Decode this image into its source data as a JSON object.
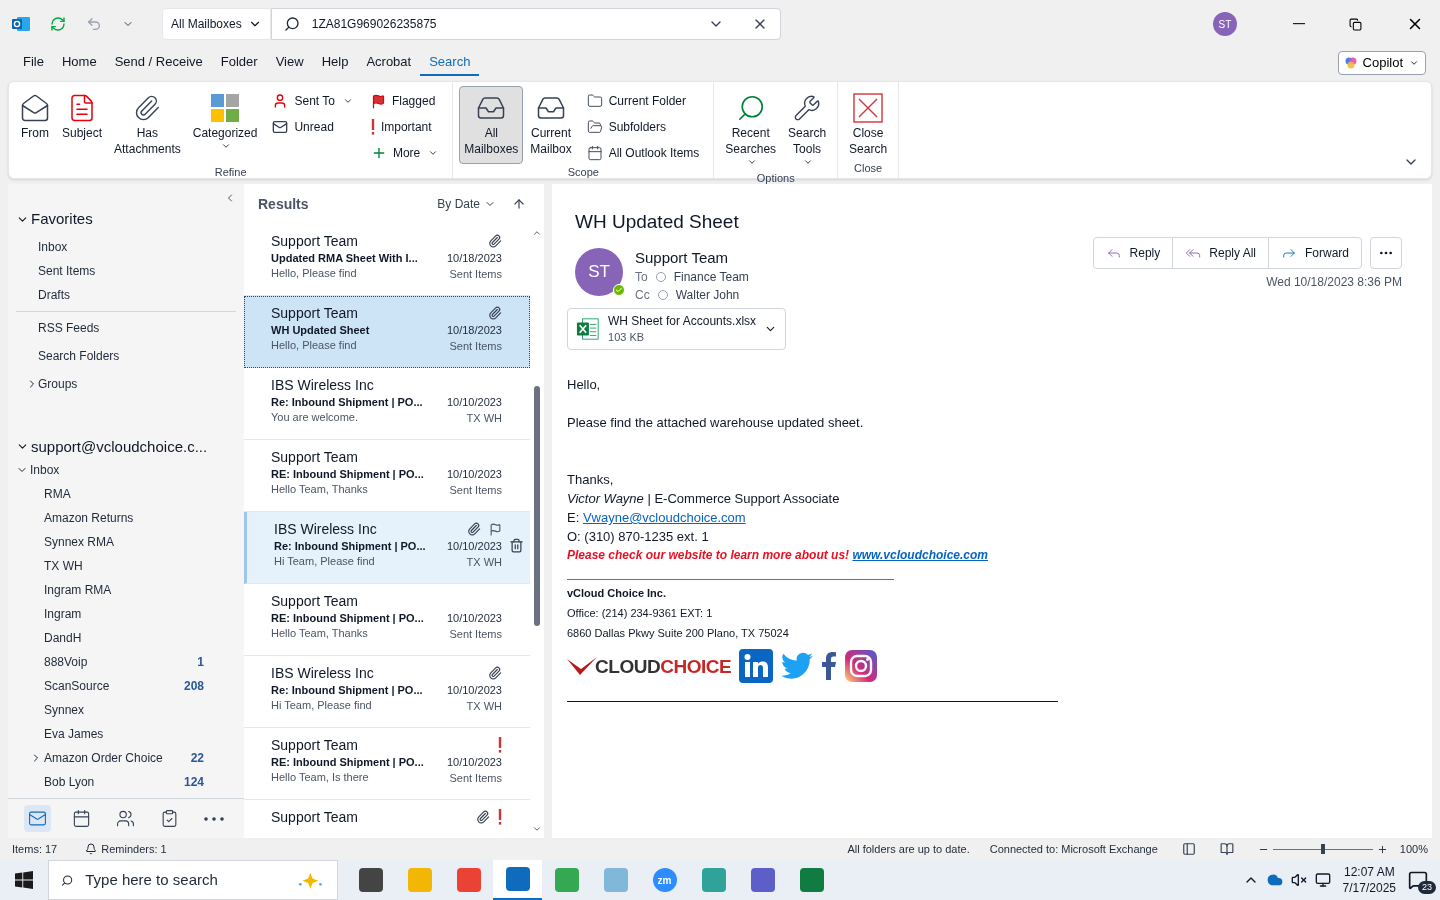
{
  "titlebar": {
    "mailbox_scope": "All Mailboxes",
    "search_query": "1ZA81G969026235875",
    "avatar": "ST"
  },
  "menu_tabs": [
    {
      "label": "File",
      "selected": false
    },
    {
      "label": "Home",
      "selected": false
    },
    {
      "label": "Send / Receive",
      "selected": false
    },
    {
      "label": "Folder",
      "selected": false
    },
    {
      "label": "View",
      "selected": false
    },
    {
      "label": "Help",
      "selected": false
    },
    {
      "label": "Acrobat",
      "selected": false
    },
    {
      "label": "Search",
      "selected": true
    }
  ],
  "copilot": "Copilot",
  "ribbon_groups": [
    {
      "label": "Refine",
      "large": [
        {
          "label": "From",
          "dropdown": false,
          "selected": false
        },
        {
          "label": "Subject",
          "dropdown": false,
          "selected": false
        },
        {
          "label": "Has Attachments",
          "dropdown": false,
          "selected": false
        },
        {
          "label": "Categorized",
          "dropdown": true,
          "selected": false
        }
      ],
      "columns": [
        [
          {
            "label": "Sent To",
            "dropdown": true
          },
          {
            "label": "Unread",
            "dropdown": false
          }
        ],
        [
          {
            "label": "Flagged",
            "dropdown": false
          },
          {
            "label": "Important",
            "dropdown": false
          },
          {
            "label": "More",
            "dropdown": true
          }
        ]
      ]
    },
    {
      "label": "Scope",
      "large": [
        {
          "label": "All Mailboxes",
          "dropdown": false,
          "selected": true
        },
        {
          "label": "Current Mailbox",
          "dropdown": false,
          "selected": false
        }
      ],
      "columns": [
        [
          {
            "label": "Current Folder",
            "dropdown": false
          },
          {
            "label": "Subfolders",
            "dropdown": false
          },
          {
            "label": "All Outlook Items",
            "dropdown": false
          }
        ]
      ]
    },
    {
      "label": "Options",
      "large": [
        {
          "label": "Recent Searches",
          "dropdown": true,
          "selected": false
        },
        {
          "label": "Search Tools",
          "dropdown": true,
          "selected": false
        }
      ]
    },
    {
      "label": "Close",
      "large": [
        {
          "label": "Close Search",
          "dropdown": false,
          "selected": false
        }
      ]
    }
  ],
  "folder_pane": {
    "favorites": {
      "label": "Favorites",
      "expanded": true,
      "children": [
        {
          "label": "Inbox"
        },
        {
          "label": "Sent Items"
        },
        {
          "label": "Drafts"
        }
      ]
    },
    "extra": [
      {
        "label": "RSS Feeds"
      },
      {
        "label": "Search Folders"
      },
      {
        "label": "Groups",
        "expanded": false
      }
    ],
    "account": {
      "label": "support@vcloudchoice.c...",
      "expanded": true,
      "children": [
        {
          "label": "Inbox",
          "expanded": true,
          "children": [
            {
              "label": "RMA"
            },
            {
              "label": "Amazon Returns"
            },
            {
              "label": "Synnex RMA"
            },
            {
              "label": "TX WH"
            },
            {
              "label": "Ingram RMA"
            },
            {
              "label": "Ingram"
            },
            {
              "label": "DandH"
            },
            {
              "label": "888Voip",
              "count": "1"
            },
            {
              "label": "ScanSource",
              "count": "208"
            },
            {
              "label": "Synnex"
            },
            {
              "label": "Eva James"
            },
            {
              "label": "Amazon Order Choice",
              "count": "22",
              "expanded": false
            },
            {
              "label": "Bob Lyon",
              "count": "124"
            }
          ]
        }
      ]
    }
  },
  "nav_modules": [
    {
      "selected": true
    },
    {
      "selected": false
    },
    {
      "selected": false
    },
    {
      "selected": false
    },
    {
      "selected": false
    }
  ],
  "message_list": {
    "title": "Results",
    "sort": "By Date",
    "messages": [
      {
        "sender": "Support Team",
        "subject": "Updated RMA Sheet With I...",
        "preview": "Hello,  Please find",
        "date": "10/18/2023",
        "folder": "Sent Items",
        "attachment": true,
        "important": false,
        "selected": false,
        "hovered": false
      },
      {
        "sender": "Support Team",
        "subject": "WH Updated Sheet",
        "preview": "Hello,  Please find",
        "date": "10/18/2023",
        "folder": "Sent Items",
        "attachment": true,
        "important": false,
        "selected": true,
        "hovered": false
      },
      {
        "sender": "IBS Wireless Inc",
        "subject": "Re: Inbound Shipment | PO...",
        "preview": "You are welcome.",
        "date": "10/10/2023",
        "folder": "TX WH",
        "attachment": false,
        "important": false,
        "selected": false,
        "hovered": false
      },
      {
        "sender": "Support Team",
        "subject": "RE: Inbound Shipment | PO...",
        "preview": "Hello Team,  Thanks",
        "date": "10/10/2023",
        "folder": "Sent Items",
        "attachment": false,
        "important": false,
        "selected": false,
        "hovered": false
      },
      {
        "sender": "IBS Wireless Inc",
        "subject": "Re: Inbound Shipment | PO...",
        "preview": "Hi Team,  Please find",
        "date": "10/10/2023",
        "folder": "TX WH",
        "attachment": true,
        "important": false,
        "selected": false,
        "hovered": true
      },
      {
        "sender": "Support Team",
        "subject": "RE: Inbound Shipment | PO...",
        "preview": "Hello Team,  Thanks",
        "date": "10/10/2023",
        "folder": "Sent Items",
        "attachment": false,
        "important": false,
        "selected": false,
        "hovered": false
      },
      {
        "sender": "IBS Wireless Inc",
        "subject": "Re: Inbound Shipment | PO...",
        "preview": "Hi Team,  Please find",
        "date": "10/10/2023",
        "folder": "TX WH",
        "attachment": true,
        "important": false,
        "selected": false,
        "hovered": false
      },
      {
        "sender": "Support Team",
        "subject": "RE: Inbound Shipment | PO...",
        "preview": "Hello Team,  Is there",
        "date": "10/10/2023",
        "folder": "Sent Items",
        "attachment": false,
        "important": true,
        "selected": false,
        "hovered": false
      },
      {
        "sender": "Support Team",
        "attachment": true,
        "important": true,
        "selected": false,
        "hovered": false
      }
    ]
  },
  "reading_pane": {
    "subject": "WH Updated Sheet",
    "avatar": "ST",
    "sender": "Support Team",
    "to_label": "To",
    "to": "Finance Team",
    "cc_label": "Cc",
    "cc": "Walter John",
    "date": "Wed 10/18/2023 8:36 PM",
    "actions": [
      "Reply",
      "Reply All",
      "Forward"
    ],
    "attachment": {
      "name": "WH Sheet for Accounts.xlsx",
      "size": "103 KB"
    },
    "body": {
      "greeting": "Hello,",
      "text": "Please find the attached warehouse updated sheet.",
      "closing": "Thanks,",
      "signature_name": "*Victor Wayne* | E-Commerce Support Associate",
      "email_label": "E: ",
      "email": "Vwayne@vcloudchoice.com",
      "phone": "O: (310) 870-1235 ext. 1",
      "promo": "Please check our website to learn more about us!",
      "website": "www.vcloudchoice.com",
      "company": "vCloud Choice Inc.",
      "office": "Office: (214) 234-9361 EXT: 1",
      "address": "6860 Dallas Pkwy Suite 200 Plano, TX 75024",
      "logo": "CLOUDCHOICE"
    }
  },
  "status_bar": {
    "items": "Items: 17",
    "reminders": "Reminders: 1",
    "sync": "All folders are up to date.",
    "connection": "Connected to: Microsoft Exchange",
    "zoom": {
      "level": 0.5,
      "reading": "100%"
    }
  },
  "taskbar": {
    "search_placeholder": "Type here to search",
    "apps": [
      {
        "selected": false
      },
      {
        "selected": false
      },
      {
        "selected": false
      },
      {
        "selected": true
      },
      {
        "selected": false
      },
      {
        "selected": false
      },
      {
        "selected": false,
        "glyph": "zm"
      },
      {
        "selected": false
      },
      {
        "selected": false
      },
      {
        "selected": false
      }
    ],
    "time": "12:07 AM",
    "date": "7/17/2025",
    "notifications": "23"
  }
}
